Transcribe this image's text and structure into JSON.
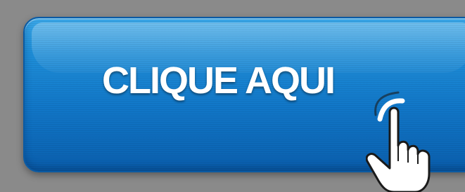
{
  "button": {
    "label": "CLIQUE AQUI",
    "color": "#1680cf"
  },
  "background": "#8a8a8a",
  "icons": {
    "cursor": "hand-pointer-icon"
  }
}
